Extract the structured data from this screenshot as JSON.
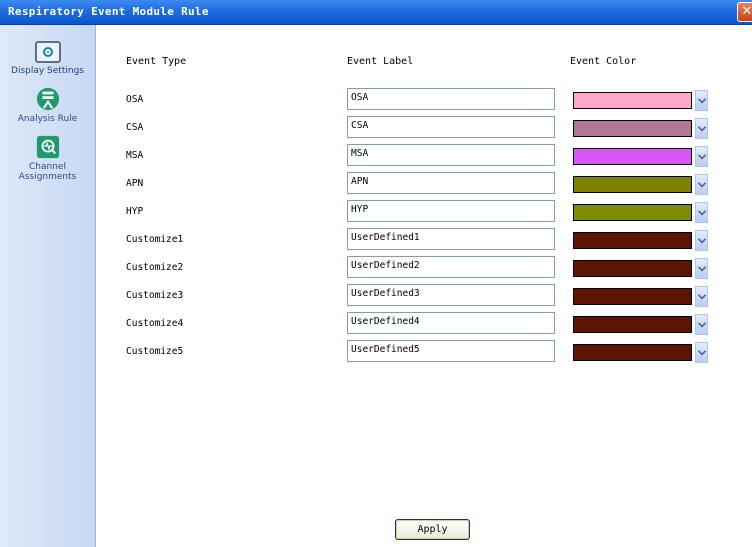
{
  "window": {
    "title": "Respiratory Event Module Rule",
    "close_glyph": "✕"
  },
  "sidebar": {
    "items": [
      {
        "label": "Display Settings",
        "icon": "display-settings-icon"
      },
      {
        "label": "Analysis Rule",
        "icon": "analysis-rule-icon"
      },
      {
        "label_line1": "Channel",
        "label_line2": "Assignments",
        "icon": "channel-assignments-icon"
      }
    ]
  },
  "headers": {
    "type": "Event Type",
    "label": "Event Label",
    "color": "Event Color"
  },
  "rows": [
    {
      "type": "OSA",
      "label": "OSA",
      "color": "#ffa6c9"
    },
    {
      "type": "CSA",
      "label": "CSA",
      "color": "#b07896"
    },
    {
      "type": "MSA",
      "label": "MSA",
      "color": "#d955f5"
    },
    {
      "type": "APN",
      "label": "APN",
      "color": "#7f7f00"
    },
    {
      "type": "HYP",
      "label": "HYP",
      "color": "#7f8b00"
    },
    {
      "type": "Customize1",
      "label": "UserDefined1",
      "color": "#5c1500"
    },
    {
      "type": "Customize2",
      "label": "UserDefined2",
      "color": "#5c1500"
    },
    {
      "type": "Customize3",
      "label": "UserDefined3",
      "color": "#5c1500"
    },
    {
      "type": "Customize4",
      "label": "UserDefined4",
      "color": "#5c1500"
    },
    {
      "type": "Customize5",
      "label": "UserDefined5",
      "color": "#5c1500"
    }
  ],
  "footer": {
    "apply_label": "Apply"
  }
}
